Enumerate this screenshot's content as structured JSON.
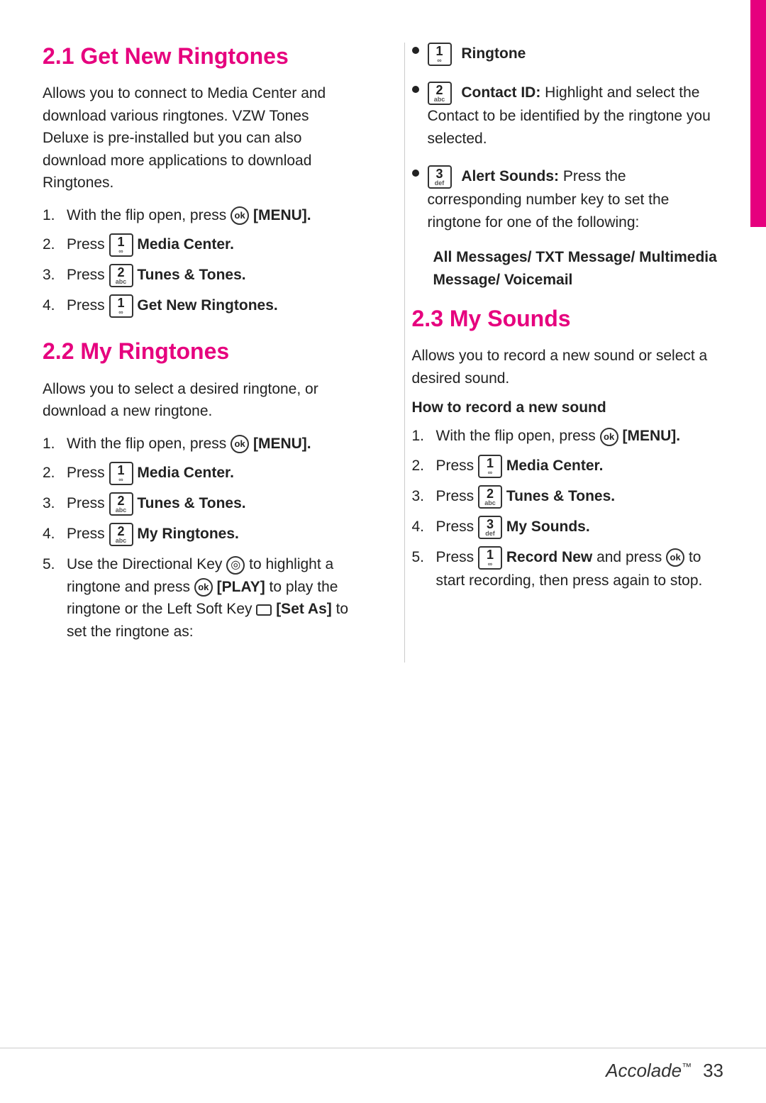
{
  "page": {
    "number": "33",
    "brand": "Accolade"
  },
  "sections": {
    "section_2_1": {
      "title": "2.1 Get New Ringtones",
      "description": "Allows you to connect to Media Center and download various ringtones. VZW Tones Deluxe is pre-installed but you can also download more applications to download Ringtones.",
      "steps": [
        {
          "num": "1.",
          "text": "With the flip open, press",
          "icon": "ok",
          "bold_text": "[MENU]."
        },
        {
          "num": "2.",
          "text": "Press",
          "icon": "1abc",
          "bold_text": "Media Center."
        },
        {
          "num": "3.",
          "text": "Press",
          "icon": "2abc",
          "bold_text": "Tunes & Tones."
        },
        {
          "num": "4.",
          "text": "Press",
          "icon": "1abc",
          "bold_text": "Get New Ringtones."
        }
      ]
    },
    "section_2_2": {
      "title": "2.2 My Ringtones",
      "description": "Allows you to select a desired ringtone, or download  a new ringtone.",
      "steps": [
        {
          "num": "1.",
          "text": "With the flip open, press",
          "icon": "ok",
          "bold_text": "[MENU]."
        },
        {
          "num": "2.",
          "text": "Press",
          "icon": "1abc",
          "bold_text": "Media Center."
        },
        {
          "num": "3.",
          "text": "Press",
          "icon": "2abc",
          "bold_text": "Tunes & Tones."
        },
        {
          "num": "4.",
          "text": "Press",
          "icon": "2abc",
          "bold_text": "My Ringtones."
        }
      ],
      "step5": "5. Use the Directional Key",
      "step5b": "to highlight a ringtone and press",
      "step5c": "[PLAY] to play the ringtone or the Left Soft Key",
      "step5d": "[Set As] to set the ringtone as:"
    },
    "right_bullets": [
      {
        "icon": "1dot",
        "label": "Ringtone",
        "description": ""
      },
      {
        "icon": "2abc",
        "label": "Contact ID:",
        "description": "Highlight and select the Contact to be identified by the ringtone you selected."
      },
      {
        "icon": "3def",
        "label": "Alert Sounds:",
        "description": "Press the corresponding number key to set the ringtone for one of the following:"
      }
    ],
    "alert_sounds_list": "All Messages/ TXT Message/ Multimedia Message/ Voicemail",
    "section_2_3": {
      "title": "2.3 My Sounds",
      "description": "Allows you to record a new sound or select a desired sound.",
      "how_to": "How to record a new sound",
      "steps": [
        {
          "num": "1.",
          "text": "With the flip open, press",
          "icon": "ok",
          "bold_text": "[MENU]."
        },
        {
          "num": "2.",
          "text": "Press",
          "icon": "1abc",
          "bold_text": "Media Center."
        },
        {
          "num": "3.",
          "text": "Press",
          "icon": "2abc",
          "bold_text": "Tunes & Tones."
        },
        {
          "num": "4.",
          "text": "Press",
          "icon": "3def",
          "bold_text": "My Sounds."
        },
        {
          "num": "5.",
          "text": "Press",
          "icon": "1abc",
          "bold_text": "Record New",
          "extra": "and press",
          "icon2": "ok",
          "extra2": "to start recording, then press again to stop."
        }
      ]
    }
  }
}
